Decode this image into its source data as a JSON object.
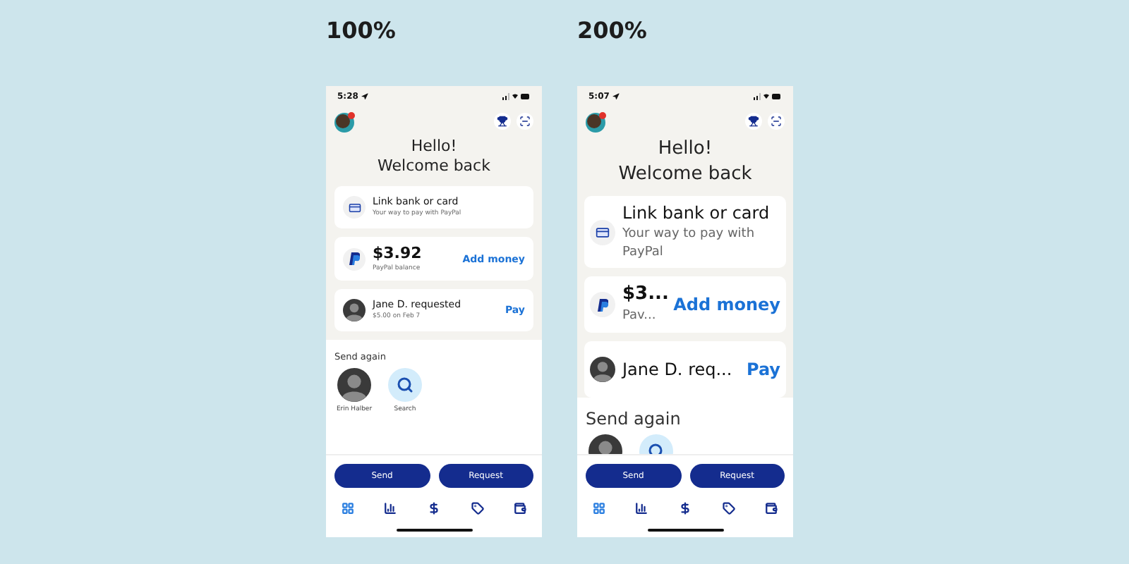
{
  "phones": [
    {
      "zoom_label": "100%",
      "kind": "normal",
      "time": "5:28",
      "greeting": "Hello!",
      "subgreeting": "Welcome back",
      "link_card": {
        "title": "Link bank or card",
        "subtitle": "Your way to pay with PayPal"
      },
      "balance_card": {
        "amount": "$3.92",
        "label": "PayPal balance",
        "action": "Add money"
      },
      "request_card": {
        "title": "Jane D. requested",
        "subtitle": "$5.00 on Feb 7",
        "action": "Pay"
      },
      "send_again": {
        "title": "Send again",
        "contacts": [
          {
            "kind": "person",
            "name": "Erin Halber"
          },
          {
            "kind": "search",
            "name": "Search"
          }
        ]
      },
      "buttons": [
        "Send",
        "Request"
      ],
      "tabs": [
        {
          "kind": "home",
          "selected": true
        },
        {
          "kind": "activity",
          "selected": false
        },
        {
          "kind": "money",
          "selected": false
        },
        {
          "kind": "deals",
          "selected": false
        },
        {
          "kind": "wallet",
          "selected": false
        }
      ]
    },
    {
      "zoom_label": "200%",
      "kind": "large",
      "time": "5:07",
      "greeting": "Hello!",
      "subgreeting": "Welcome back",
      "link_card": {
        "title": "Link bank or card",
        "subtitle": "Your way to pay with PayPal"
      },
      "balance_card": {
        "amount": "$3...",
        "label": "Pav...",
        "action": "Add money"
      },
      "request_card": {
        "title": "Jane D. req...",
        "action": "Pay"
      },
      "send_again": {
        "title": "Send again",
        "contacts": [
          {
            "kind": "person"
          },
          {
            "kind": "search"
          }
        ]
      },
      "buttons": [
        "Send",
        "Request"
      ],
      "tabs": [
        {
          "kind": "home",
          "selected": true
        },
        {
          "kind": "activity",
          "selected": false
        },
        {
          "kind": "money",
          "selected": false
        },
        {
          "kind": "deals",
          "selected": false
        },
        {
          "kind": "wallet",
          "selected": false
        }
      ]
    }
  ]
}
